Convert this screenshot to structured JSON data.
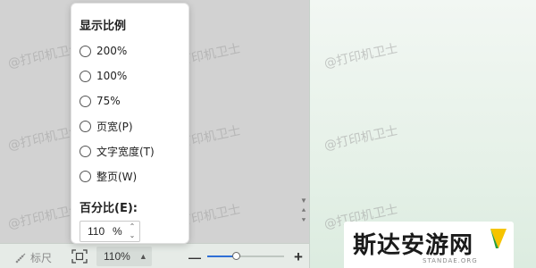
{
  "watermark_text": "@打印机卫士",
  "zoom_popup": {
    "title": "显示比例",
    "options": [
      {
        "label": "200%",
        "selected": false
      },
      {
        "label": "100%",
        "selected": false
      },
      {
        "label": "75%",
        "selected": false
      },
      {
        "label": "页宽(P)",
        "selected": false
      },
      {
        "label": "文字宽度(T)",
        "selected": false
      },
      {
        "label": "整页(W)",
        "selected": false
      }
    ],
    "percent_label": "百分比(E):",
    "percent_value": "110",
    "percent_unit": "%"
  },
  "status_bar": {
    "ruler_label": "标尺",
    "zoom_value": "110%",
    "zoom_slider_fraction": 0.37,
    "minus_icon": "minus-icon",
    "plus_icon": "plus-icon"
  },
  "brand": {
    "name": "斯达安游网",
    "domain": "STANDAE.ORG"
  },
  "colors": {
    "accent": "#2f6fd6",
    "popup_bg": "#ffffff",
    "pane_bg": "#e6f1e8"
  }
}
